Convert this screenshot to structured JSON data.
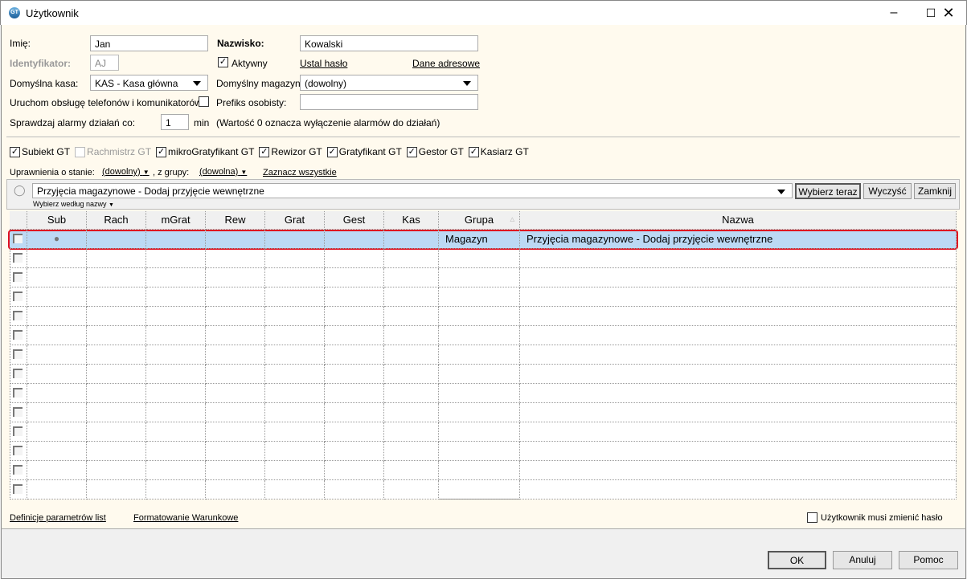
{
  "window": {
    "title": "Użytkownik",
    "icon": "subiekt-gt-icon",
    "controls": [
      "minimize",
      "maximize",
      "close"
    ]
  },
  "form": {
    "imie_label": "Imię:",
    "imie_value": "Jan",
    "nazwisko_label": "Nazwisko:",
    "nazwisko_value": "Kowalski",
    "identyfikator_label": "Identyfikator:",
    "identyfikator_value": "AJ",
    "aktywny_label": "Aktywny",
    "aktywny_checked": true,
    "ustal_haslo": "Ustal hasło",
    "dane_adresowe": "Dane adresowe",
    "kasa_label": "Domyślna kasa:",
    "kasa_value": "KAS - Kasa główna",
    "magazyn_label": "Domyślny magazyn:",
    "magazyn_value": "(dowolny)",
    "telefony_label": "Uruchom obsługę telefonów i komunikatorów",
    "telefony_checked": false,
    "prefiks_label": "Prefiks osobisty:",
    "prefiks_value": "",
    "alarmy_label": "Sprawdzaj alarmy działań co:",
    "alarmy_value": "1",
    "alarmy_unit": "min",
    "alarmy_note": "(Wartość 0 oznacza wyłączenie alarmów do działań)"
  },
  "modules": [
    {
      "label": "Subiekt GT",
      "checked": true,
      "enabled": true
    },
    {
      "label": "Rachmistrz GT",
      "checked": false,
      "enabled": false
    },
    {
      "label": "mikroGratyfikant GT",
      "checked": true,
      "enabled": true
    },
    {
      "label": "Rewizor GT",
      "checked": true,
      "enabled": true
    },
    {
      "label": "Gratyfikant GT",
      "checked": true,
      "enabled": true
    },
    {
      "label": "Gestor GT",
      "checked": true,
      "enabled": true
    },
    {
      "label": "Kasiarz GT",
      "checked": true,
      "enabled": true
    }
  ],
  "permissions": {
    "stan_label": "Uprawnienia o stanie:",
    "stan_value": "(dowolny)",
    "grupa_label": ", z grupy:",
    "grupa_value": "(dowolna)",
    "select_all": "Zaznacz wszystkie"
  },
  "filter": {
    "value": "Przyjęcia magazynowe - Dodaj przyjęcie wewnętrzne",
    "choose_now": "Wybierz teraz",
    "clear": "Wyczyść",
    "close": "Zamknij",
    "by_name": "Wybierz według nazwy"
  },
  "grid": {
    "columns": [
      "Sub",
      "Rach",
      "mGrat",
      "Rew",
      "Grat",
      "Gest",
      "Kas",
      "Grupa",
      "Nazwa"
    ],
    "sort_column": "Grupa",
    "rows": [
      {
        "sub": "●",
        "grupa": "Magazyn",
        "nazwa": "Przyjęcia magazynowe - Dodaj przyjęcie wewnętrzne",
        "selected": true
      }
    ],
    "empty_rows": 13
  },
  "footer": {
    "definicje": "Definicje parametrów list",
    "formatowanie": "Formatowanie Warunkowe",
    "must_change_label": "Użytkownik musi zmienić hasło",
    "must_change_checked": false
  },
  "buttons": {
    "ok": "OK",
    "cancel": "Anuluj",
    "help": "Pomoc"
  },
  "colors": {
    "form_bg": "#fffaee",
    "selection": "#bcd9f4",
    "highlight_border": "#e01020"
  }
}
